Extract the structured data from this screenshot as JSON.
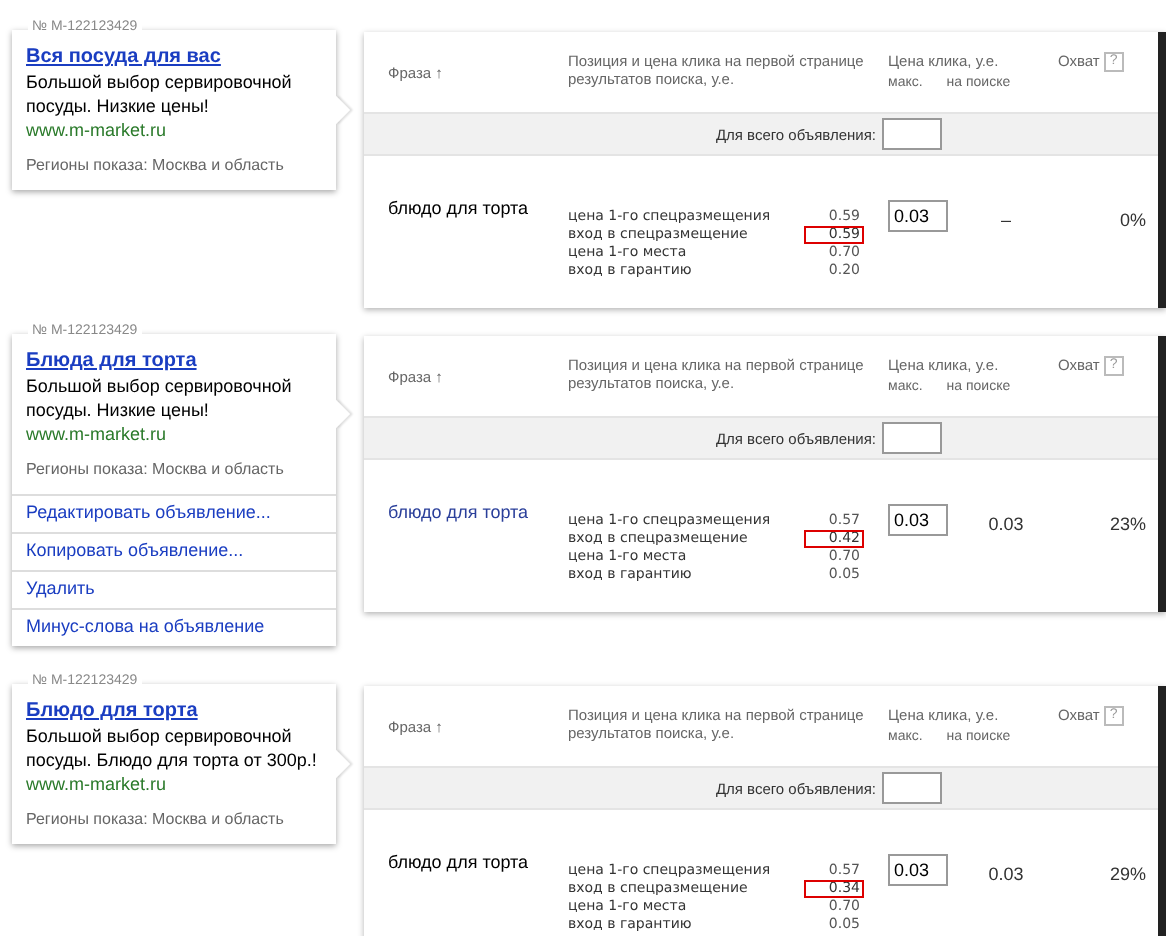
{
  "ads": [
    {
      "number": "№ M-122123429",
      "title": "Вся посуда для вас",
      "text": "Большой выбор сервировочной посуды. Низкие цены!",
      "url": "www.m-market.ru",
      "regions": "Регионы показа: Москва и область",
      "columns": {
        "phrase": "Фраза",
        "sort_mark": "↑",
        "position": "Позиция и цена клика на первой странице результатов поиска, у.е.",
        "price": "Цена клика, у.е.",
        "max": "макс.",
        "on_search": "на поиске",
        "coverage": "Охват",
        "help": "?"
      },
      "whole_ad_label": "Для всего объявления:",
      "phrase": "блюдо для торта",
      "phrase_active": false,
      "prices": [
        {
          "label": "цена 1-го спецразмещения",
          "value": "0.59",
          "highlighted": false
        },
        {
          "label": "вход в спецразмещение",
          "value": "0.59",
          "highlighted": true
        },
        {
          "label": "цена 1-го места",
          "value": "0.70",
          "highlighted": false
        },
        {
          "label": "вход в гарантию",
          "value": "0.20",
          "highlighted": false
        }
      ],
      "max_bid": "0.03",
      "on_search": "–",
      "coverage": "0%"
    },
    {
      "number": "№ M-122123429",
      "title": "Блюда для торта",
      "text": "Большой выбор сервировочной посуды. Низкие цены!",
      "url": "www.m-market.ru",
      "regions": "Регионы показа: Москва и область",
      "actions": [
        "Редактировать объявление...",
        "Копировать объявление...",
        "Удалить",
        "Минус-слова на объявление"
      ],
      "columns": {
        "phrase": "Фраза",
        "sort_mark": "↑",
        "position": "Позиция и цена клика на первой странице результатов поиска, у.е.",
        "price": "Цена клика, у.е.",
        "max": "макс.",
        "on_search": "на поиске",
        "coverage": "Охват",
        "help": "?"
      },
      "whole_ad_label": "Для всего объявления:",
      "phrase": "блюдо для торта",
      "phrase_active": true,
      "prices": [
        {
          "label": "цена 1-го спецразмещения",
          "value": "0.57",
          "highlighted": false
        },
        {
          "label": "вход в спецразмещение",
          "value": "0.42",
          "highlighted": true
        },
        {
          "label": "цена 1-го места",
          "value": "0.70",
          "highlighted": false
        },
        {
          "label": "вход в гарантию",
          "value": "0.05",
          "highlighted": false
        }
      ],
      "max_bid": "0.03",
      "on_search": "0.03",
      "coverage": "23%"
    },
    {
      "number": "№ M-122123429",
      "title": "Блюдо для торта",
      "text": "Большой выбор сервировочной посуды. Блюдо для торта от 300р.!",
      "url": "www.m-market.ru",
      "regions": "Регионы показа: Москва и область",
      "columns": {
        "phrase": "Фраза",
        "sort_mark": "↑",
        "position": "Позиция и цена клика на первой странице результатов поиска, у.е.",
        "price": "Цена клика, у.е.",
        "max": "макс.",
        "on_search": "на поиске",
        "coverage": "Охват",
        "help": "?"
      },
      "whole_ad_label": "Для всего объявления:",
      "phrase": "блюдо для торта",
      "phrase_active": false,
      "prices": [
        {
          "label": "цена 1-го спецразмещения",
          "value": "0.57",
          "highlighted": false
        },
        {
          "label": "вход в спецразмещение",
          "value": "0.34",
          "highlighted": true
        },
        {
          "label": "цена 1-го места",
          "value": "0.70",
          "highlighted": false
        },
        {
          "label": "вход в гарантию",
          "value": "0.05",
          "highlighted": false
        }
      ],
      "max_bid": "0.03",
      "on_search": "0.03",
      "coverage": "29%"
    }
  ]
}
